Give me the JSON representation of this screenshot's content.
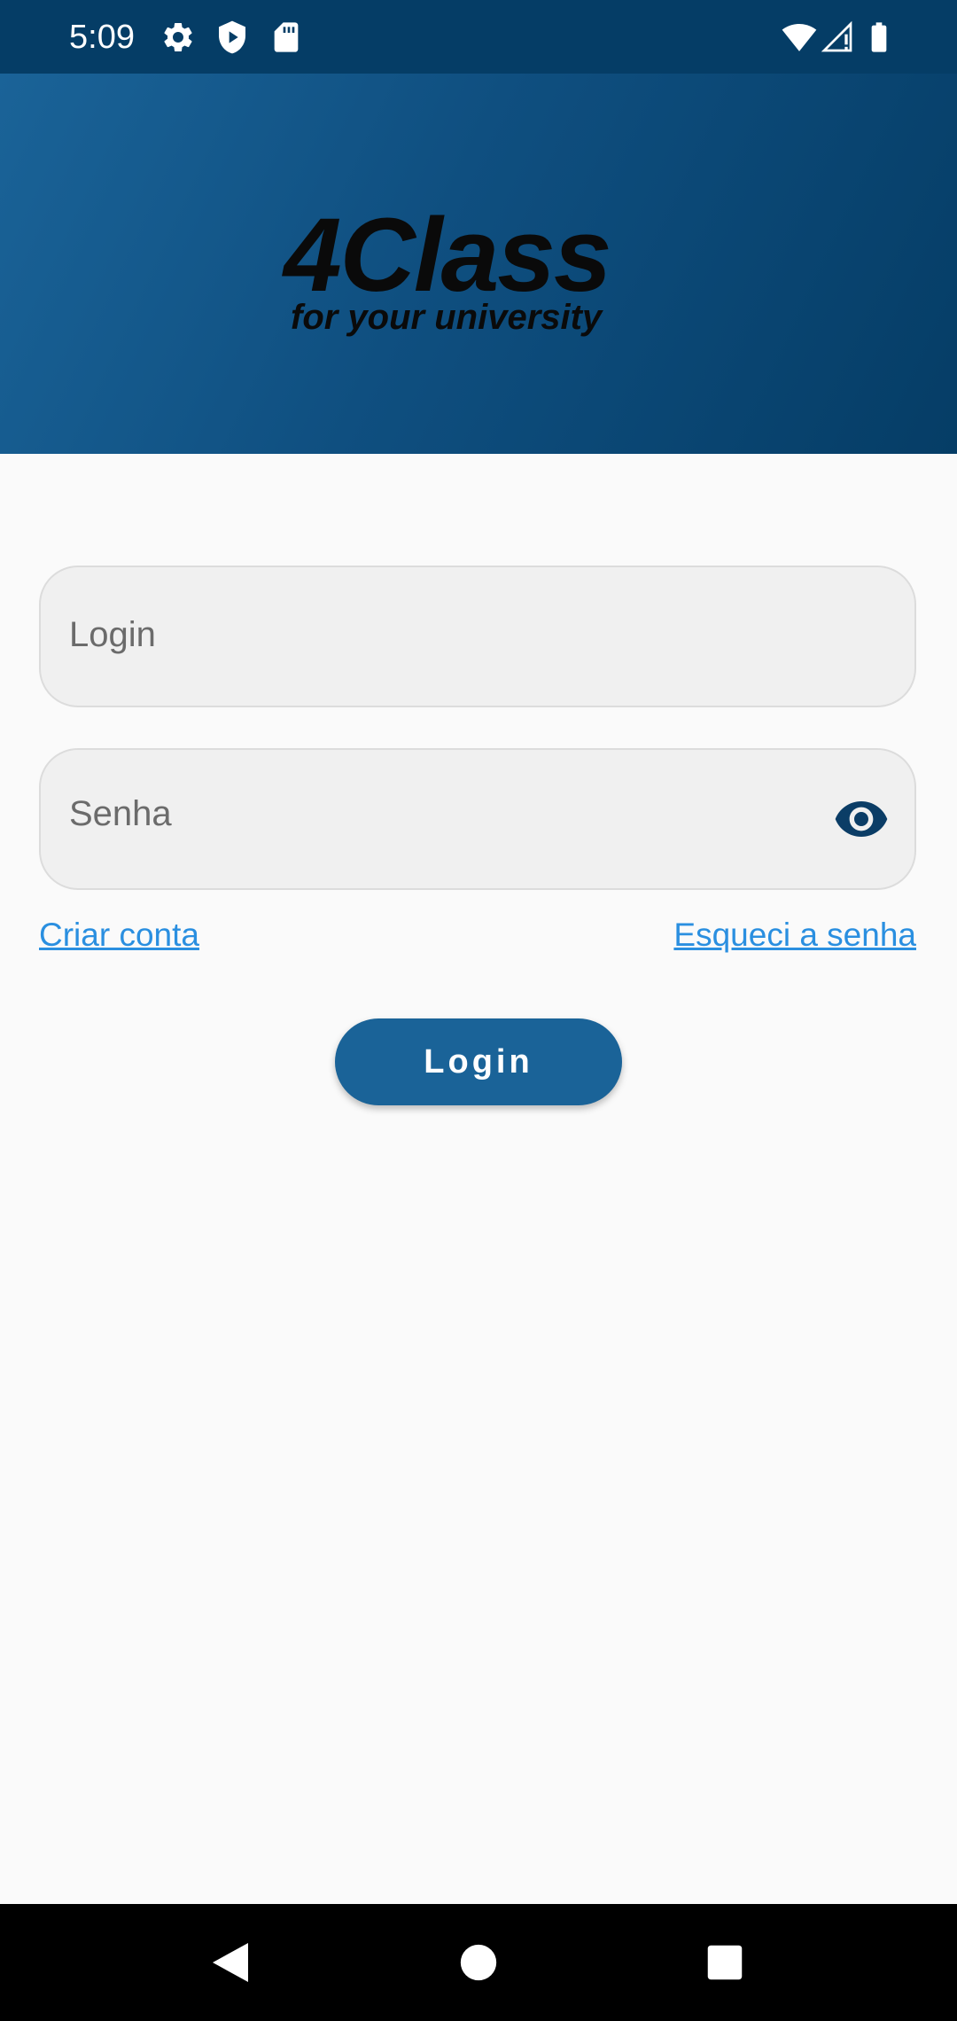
{
  "status_bar": {
    "time": "5:09",
    "icons": [
      "settings-icon",
      "shield-play-icon",
      "sd-card-icon",
      "wifi-icon",
      "signal-icon",
      "battery-icon"
    ]
  },
  "header": {
    "logo_title": "4Class",
    "logo_subtitle": "for your university"
  },
  "form": {
    "login_placeholder": "Login",
    "login_value": "",
    "password_placeholder": "Senha",
    "password_value": "",
    "password_toggle_icon": "eye-icon",
    "create_account_link": "Criar conta",
    "forgot_password_link": "Esqueci a senha",
    "submit_label": "Login"
  },
  "nav_bar": {
    "icons": [
      "back-icon",
      "home-icon",
      "recents-icon"
    ]
  },
  "colors": {
    "primary": "#1a6398",
    "status_bar": "#053d66",
    "link": "#2a8fe0",
    "background": "#fafafa",
    "field_background": "#f0f0f0",
    "eye_icon": "#0b3d66"
  }
}
